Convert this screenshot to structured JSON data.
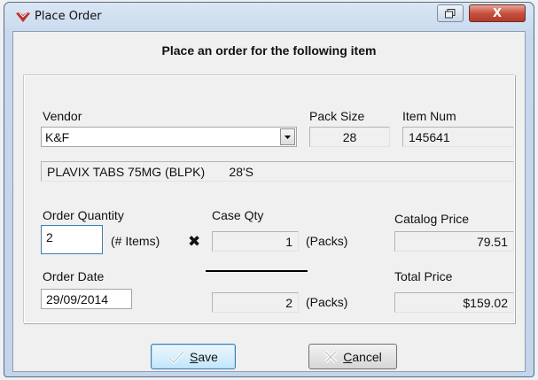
{
  "window": {
    "title": "Place Order",
    "close_label": "X"
  },
  "heading": "Place an order for the following item",
  "vendor": {
    "label": "Vendor",
    "value": "K&F"
  },
  "pack_size": {
    "label": "Pack Size",
    "value": "28"
  },
  "item_num": {
    "label": "Item Num",
    "value": "145641"
  },
  "description": "PLAVIX TABS 75MG (BLPK)       28'S",
  "order_quantity": {
    "label": "Order Quantity",
    "value": "2",
    "unit": "(# Items)"
  },
  "multiply_symbol": "✖",
  "case_qty": {
    "label": "Case Qty",
    "value": "1",
    "unit": "(Packs)"
  },
  "catalog_price": {
    "label": "Catalog Price",
    "value": "79.51"
  },
  "order_date": {
    "label": "Order Date",
    "value": "29/09/2014"
  },
  "total_packs": {
    "value": "2",
    "unit": "(Packs)"
  },
  "total_price": {
    "label": "Total Price",
    "value": "$159.02"
  },
  "buttons": {
    "save_first": "S",
    "save_rest": "ave",
    "cancel_first": "C",
    "cancel_rest": "ancel"
  },
  "colors": {
    "close_button": "#c6513f",
    "focus_border": "#3c7fb1",
    "title_bar": "#c7d8ec"
  }
}
